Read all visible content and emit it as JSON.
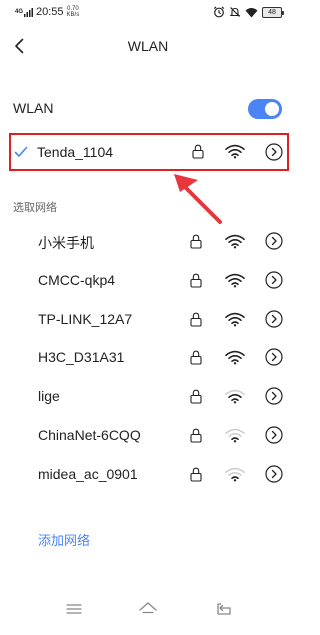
{
  "status_bar": {
    "network_type": "4G",
    "time": "20:55",
    "speed_value": "0.70",
    "speed_unit": "KB/s",
    "battery": "48"
  },
  "header": {
    "back_icon": "chevron-left-icon",
    "title": "WLAN"
  },
  "wlan_toggle": {
    "label": "WLAN",
    "state": "on"
  },
  "connected_network": {
    "name": "Tenda_1104",
    "secured": true,
    "signal": "strong"
  },
  "section_label": "选取网络",
  "networks": [
    {
      "name": "小米手机",
      "secured": true,
      "signal": "strong"
    },
    {
      "name": "CMCC-qkp4",
      "secured": true,
      "signal": "strong"
    },
    {
      "name": "TP-LINK_12A7",
      "secured": true,
      "signal": "strong"
    },
    {
      "name": "H3C_D31A31",
      "secured": true,
      "signal": "strong"
    },
    {
      "name": "lige",
      "secured": true,
      "signal": "medium"
    },
    {
      "name": "ChinaNet-6CQQ",
      "secured": true,
      "signal": "weak"
    },
    {
      "name": "midea_ac_0901",
      "secured": true,
      "signal": "weak"
    }
  ],
  "add_network_label": "添加网络",
  "colors": {
    "accent": "#4a84f5",
    "highlight_border": "#e02020",
    "annotation_arrow": "#e8363d"
  },
  "nav_icons": [
    "menu-icon",
    "home-icon",
    "back-icon"
  ]
}
